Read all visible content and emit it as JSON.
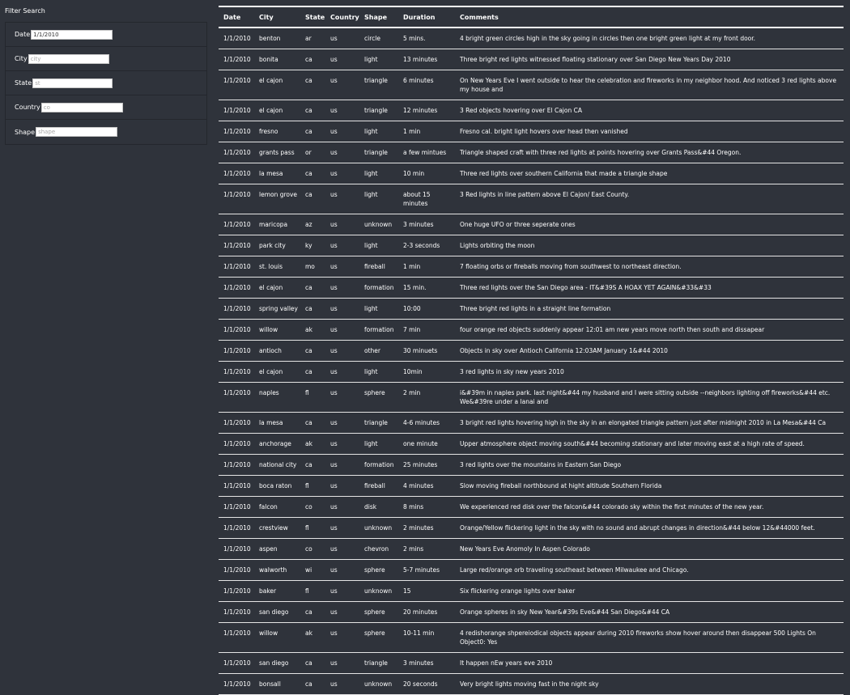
{
  "sidebar": {
    "title": "Filter Search",
    "filters": [
      {
        "id": "date",
        "label": "Date",
        "value": "1/1/2010",
        "placeholder": "",
        "width": 101
      },
      {
        "id": "city",
        "label": "City",
        "value": "",
        "placeholder": "city",
        "width": 100
      },
      {
        "id": "state",
        "label": "State",
        "value": "",
        "placeholder": "st",
        "width": 99
      },
      {
        "id": "country",
        "label": "Country",
        "value": "",
        "placeholder": "co",
        "width": 101
      },
      {
        "id": "shape",
        "label": "Shape",
        "value": "",
        "placeholder": "shape",
        "width": 101
      }
    ]
  },
  "table": {
    "columns": [
      "Date",
      "City",
      "State",
      "Country",
      "Shape",
      "Duration",
      "Comments"
    ],
    "rows": [
      [
        "1/1/2010",
        "benton",
        "ar",
        "us",
        "circle",
        "5 mins.",
        "4 bright green circles high in the sky going in circles then one bright green light at my front door."
      ],
      [
        "1/1/2010",
        "bonita",
        "ca",
        "us",
        "light",
        "13 minutes",
        "Three bright red lights witnessed floating stationary over San Diego New Years Day 2010"
      ],
      [
        "1/1/2010",
        "el cajon",
        "ca",
        "us",
        "triangle",
        "6 minutes",
        "On New Years Eve I went outside to hear the celebration and fireworks in my neighbor hood. And noticed 3 red lights above my house and"
      ],
      [
        "1/1/2010",
        "el cajon",
        "ca",
        "us",
        "triangle",
        "12 minutes",
        "3 Red objects hovering over El Cajon CA"
      ],
      [
        "1/1/2010",
        "fresno",
        "ca",
        "us",
        "light",
        "1 min",
        "Fresno cal. bright light hovers over head then vanished"
      ],
      [
        "1/1/2010",
        "grants pass",
        "or",
        "us",
        "triangle",
        "a few mintues",
        "Triangle shaped craft with three red lights at points hovering over Grants Pass&#44 Oregon."
      ],
      [
        "1/1/2010",
        "la mesa",
        "ca",
        "us",
        "light",
        "10 min",
        "Three red lights over southern California that made a triangle shape"
      ],
      [
        "1/1/2010",
        "lemon grove",
        "ca",
        "us",
        "light",
        "about 15 minutes",
        "3 Red lights in line pattern above El Cajon/ East County."
      ],
      [
        "1/1/2010",
        "maricopa",
        "az",
        "us",
        "unknown",
        "3 minutes",
        "One huge UFO or three seperate ones"
      ],
      [
        "1/1/2010",
        "park city",
        "ky",
        "us",
        "light",
        "2-3 seconds",
        "Lights orbiting the moon"
      ],
      [
        "1/1/2010",
        "st. louis",
        "mo",
        "us",
        "fireball",
        "1 min",
        "7 floating orbs or fireballs moving from southwest to northeast direction."
      ],
      [
        "1/1/2010",
        "el cajon",
        "ca",
        "us",
        "formation",
        "15 min.",
        "Three red lights over the San Diego area - IT&#39S A HOAX YET AGAIN&#33&#33"
      ],
      [
        "1/1/2010",
        "spring valley",
        "ca",
        "us",
        "light",
        "10:00",
        "Three bright red lights in a straight line formation"
      ],
      [
        "1/1/2010",
        "willow",
        "ak",
        "us",
        "formation",
        "7 min",
        "four orange red objects suddenly appear 12:01 am new years move north then south and dissapear"
      ],
      [
        "1/1/2010",
        "antioch",
        "ca",
        "us",
        "other",
        "30 minuets",
        "Objects in sky over Antioch California 12:03AM January 1&#44 2010"
      ],
      [
        "1/1/2010",
        "el cajon",
        "ca",
        "us",
        "light",
        "10min",
        "3 red lights in sky new years 2010"
      ],
      [
        "1/1/2010",
        "naples",
        "fl",
        "us",
        "sphere",
        "2 min",
        "i&#39m in naples park. last night&#44 my husband and I were sitting outside --neighbors lighting off fireworks&#44 etc. We&#39re under a lanai and"
      ],
      [
        "1/1/2010",
        "la mesa",
        "ca",
        "us",
        "triangle",
        "4-6 minutes",
        "3 bright red lights hovering high in the sky in an elongated triangle pattern just after midnight 2010 in La Mesa&#44 Ca"
      ],
      [
        "1/1/2010",
        "anchorage",
        "ak",
        "us",
        "light",
        "one minute",
        "Upper atmosphere object moving south&#44 becoming stationary and later moving east at a high rate of speed."
      ],
      [
        "1/1/2010",
        "national city",
        "ca",
        "us",
        "formation",
        "25 minutes",
        "3 red lights over the mountains in Eastern San Diego"
      ],
      [
        "1/1/2010",
        "boca raton",
        "fl",
        "us",
        "fireball",
        "4 minutes",
        "Slow moving fireball northbound at hight altitude Southern Florida"
      ],
      [
        "1/1/2010",
        "falcon",
        "co",
        "us",
        "disk",
        "8 mins",
        "We experienced red disk over the falcon&#44 colorado sky within the first minutes of the new year."
      ],
      [
        "1/1/2010",
        "crestview",
        "fl",
        "us",
        "unknown",
        "2 minutes",
        "Orange/Yellow flickering light in the sky with no sound and abrupt changes in direction&#44 below 12&#44000 feet."
      ],
      [
        "1/1/2010",
        "aspen",
        "co",
        "us",
        "chevron",
        "2 mins",
        "New Years Eve Anomoly In Aspen Colorado"
      ],
      [
        "1/1/2010",
        "walworth",
        "wi",
        "us",
        "sphere",
        "5-7 minutes",
        "Large red/orange orb traveling southeast between Milwaukee and Chicago."
      ],
      [
        "1/1/2010",
        "baker",
        "fl",
        "us",
        "unknown",
        "15",
        "Six flickering orange lights over baker"
      ],
      [
        "1/1/2010",
        "san diego",
        "ca",
        "us",
        "sphere",
        "20 minutes",
        "Orange spheres in sky New Year&#39s Eve&#44 San Diego&#44 CA"
      ],
      [
        "1/1/2010",
        "willow",
        "ak",
        "us",
        "sphere",
        "10-11 min",
        "4 redishorange shpereiodical objects appear during 2010 fireworks show hover around then disappear 500 Lights On Object0: Yes"
      ],
      [
        "1/1/2010",
        "san diego",
        "ca",
        "us",
        "triangle",
        "3 minutes",
        "It happen nEw years eve 2010"
      ],
      [
        "1/1/2010",
        "bonsall",
        "ca",
        "us",
        "unknown",
        "20 seconds",
        "Very bright lights moving fast in the night sky"
      ]
    ]
  }
}
